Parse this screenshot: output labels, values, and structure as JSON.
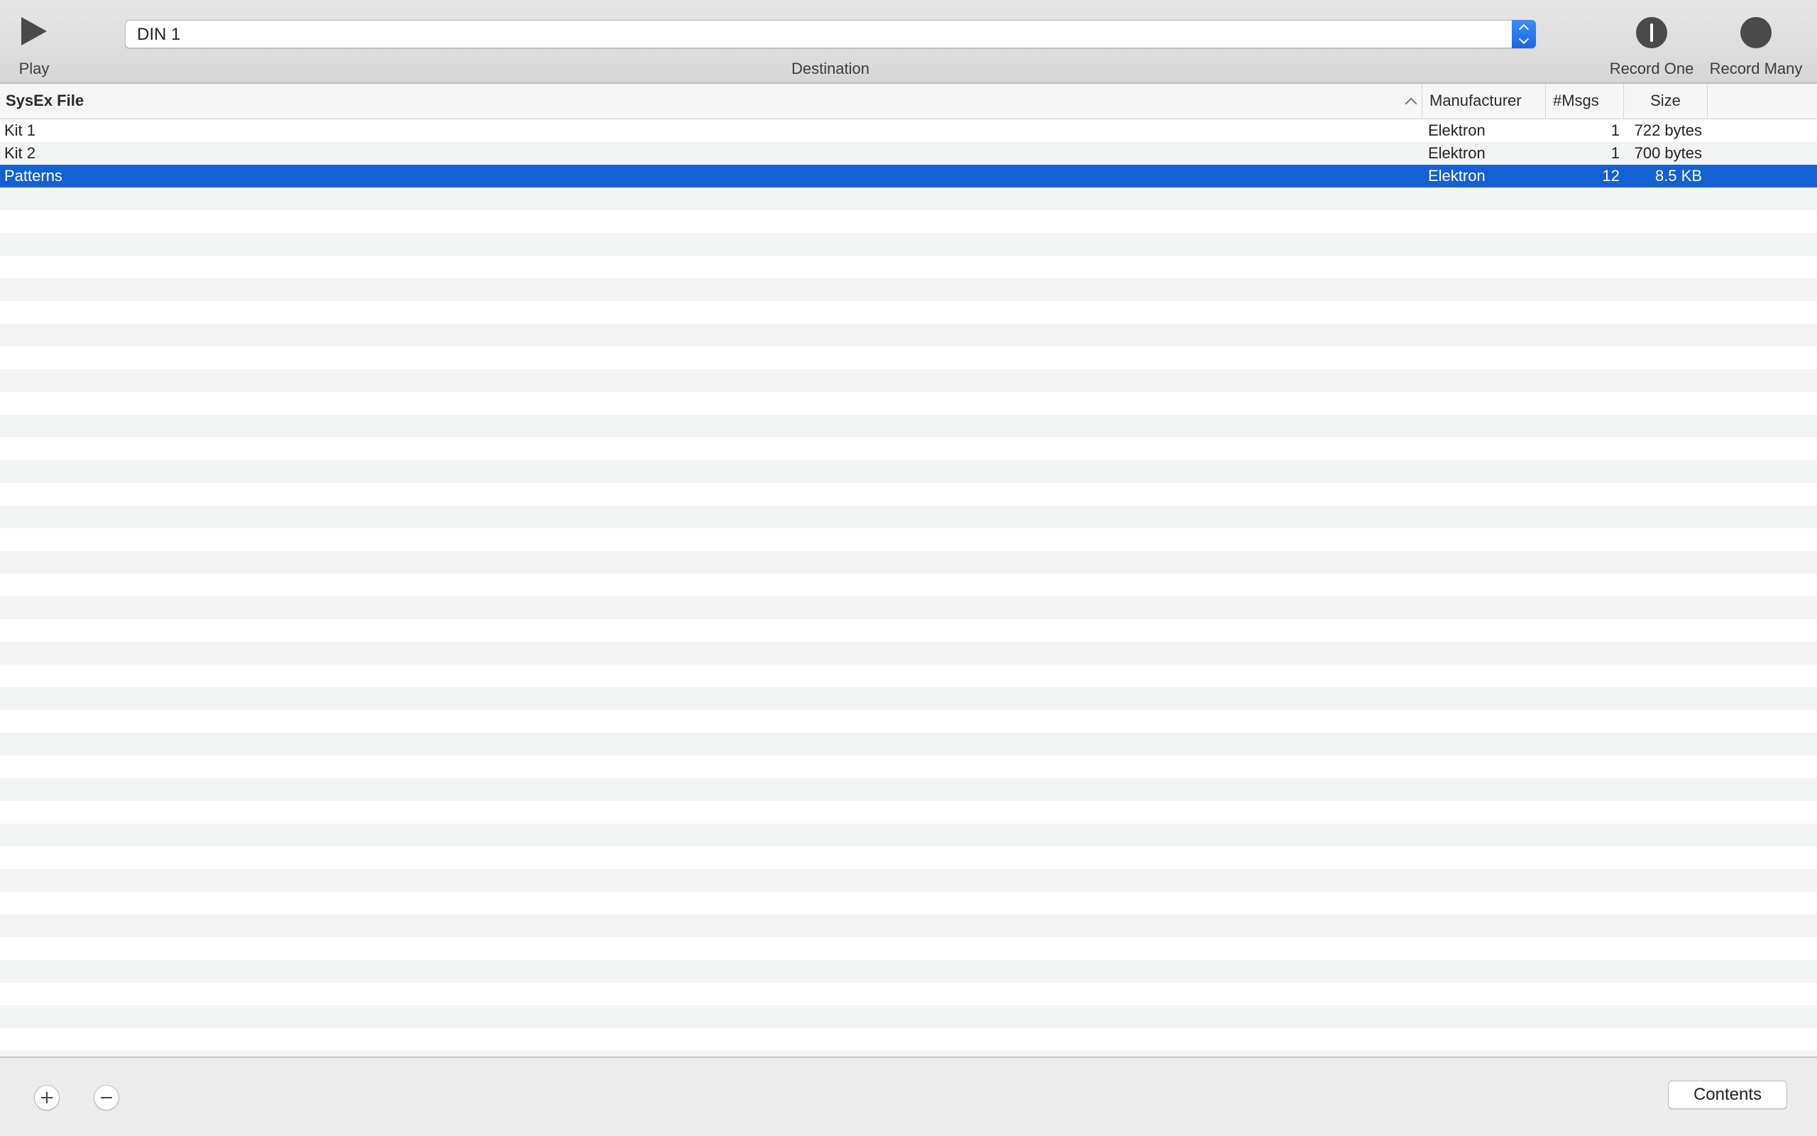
{
  "toolbar": {
    "play_label": "Play",
    "destination_label": "Destination",
    "destination_value": "DIN 1",
    "record_one_label": "Record One",
    "record_many_label": "Record Many"
  },
  "table": {
    "columns": [
      "SysEx File",
      "Manufacturer",
      "#Msgs",
      "Size"
    ],
    "sorted_column": "SysEx File",
    "sort_direction": "ascending",
    "rows": [
      {
        "name": "Kit 1",
        "manufacturer": "Elektron",
        "msgs": "1",
        "size": "722 bytes"
      },
      {
        "name": "Kit 2",
        "manufacturer": "Elektron",
        "msgs": "1",
        "size": "700 bytes"
      },
      {
        "name": "Patterns",
        "manufacturer": "Elektron",
        "msgs": "12",
        "size": "8.5 KB"
      }
    ],
    "selected_row": "Patterns"
  },
  "footer": {
    "contents_label": "Contents"
  },
  "icons": {
    "play": "play-icon",
    "record_one": "record-one-icon",
    "record_many": "record-many-icon",
    "add": "plus-icon",
    "remove": "minus-icon",
    "popup": "chevron-up-down-icon",
    "sort": "sort-ascending-icon"
  },
  "colors": {
    "selection": "#1461d5",
    "popup_accent": "#2a78ee",
    "stripe": "#f3f4f4"
  }
}
